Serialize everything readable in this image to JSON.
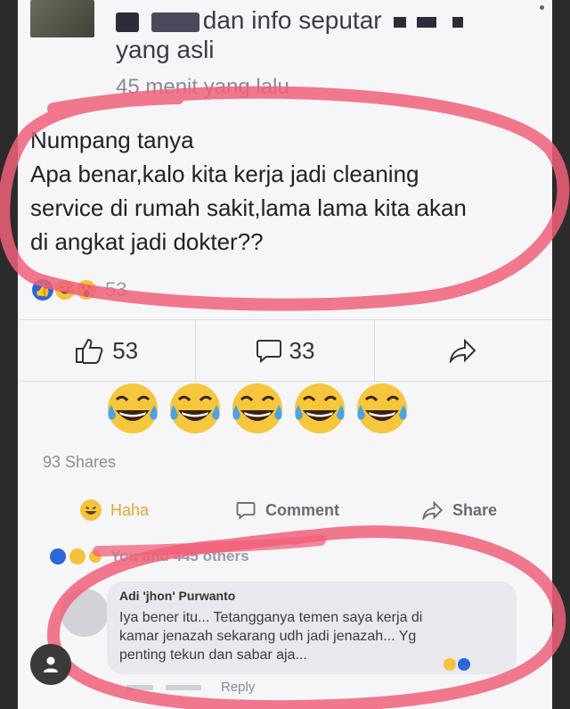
{
  "header": {
    "line1": "dan info seputar",
    "line2": "yang asli",
    "timestamp": "45 menit yang lalu"
  },
  "post": {
    "lines": [
      "Numpang tanya",
      "Apa benar,kalo kita kerja jadi cleaning",
      "service di rumah sakit,lama lama kita akan",
      "di angkat jadi dokter??"
    ]
  },
  "reactions": {
    "count": "53"
  },
  "action_bar": {
    "like_count": "53",
    "comment_count": "33"
  },
  "shares": "93 Shares",
  "actions": {
    "haha": "Haha",
    "comment": "Comment",
    "share": "Share"
  },
  "likes_summary": "You and 445 others",
  "comment": {
    "author": "Adi 'jhon' Purwanto",
    "lines": [
      "Iya bener itu... Tetangganya temen saya kerja di",
      "kamar jenazah sekarang udh jadi jenazah... Yg",
      "penting tekun dan sabar aja..."
    ],
    "reply": "Reply"
  },
  "colors": {
    "highlight_circle": "#f0607a",
    "like_blue": "#2d66d8",
    "haha_yellow": "#f5c33b"
  }
}
